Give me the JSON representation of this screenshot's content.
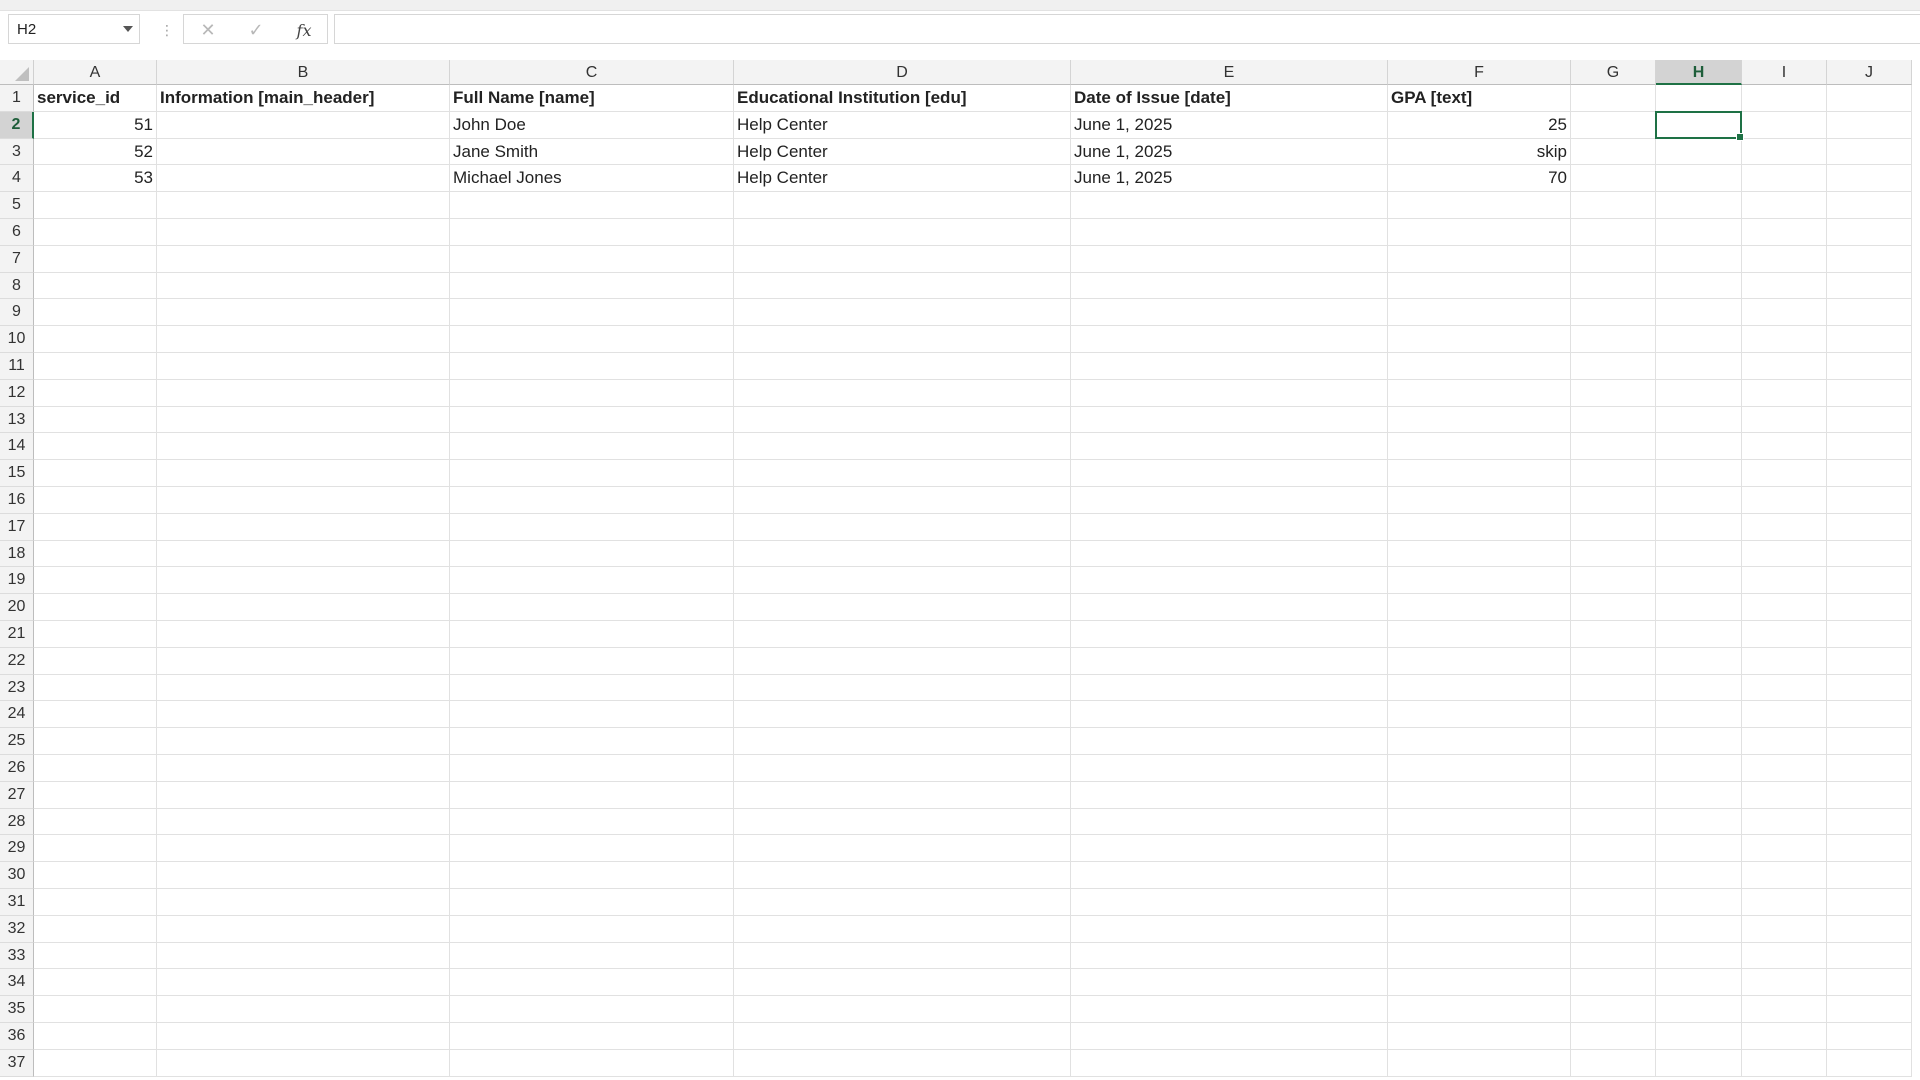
{
  "formula_bar": {
    "name_box": "H2",
    "separator": "⋮",
    "cancel_icon": "✕",
    "enter_icon": "✓",
    "fx_label": "fx",
    "formula": ""
  },
  "columns": [
    "A",
    "B",
    "C",
    "D",
    "E",
    "F",
    "G",
    "H",
    "I",
    "J"
  ],
  "rows": [
    "1",
    "2",
    "3",
    "4",
    "5",
    "6",
    "7",
    "8",
    "9",
    "10",
    "11",
    "12",
    "13",
    "14",
    "15",
    "16",
    "17",
    "18",
    "19",
    "20",
    "21",
    "22",
    "23",
    "24",
    "25",
    "26",
    "27",
    "28",
    "29",
    "30",
    "31",
    "32",
    "33",
    "34",
    "35",
    "36",
    "37"
  ],
  "active_cell": {
    "column": "H",
    "row": "2"
  },
  "accent_color": "#1e7145",
  "cells": {
    "A1": "service_id",
    "B1": "Information [main_header]",
    "C1": "Full Name [name]",
    "D1": "Educational Institution [edu]",
    "E1": "Date of Issue [date]",
    "F1": "GPA [text]",
    "A2": "51",
    "C2": "John Doe",
    "D2": "Help Center",
    "E2": "June 1, 2025",
    "F2": "25",
    "A3": "52",
    "C3": "Jane Smith",
    "D3": "Help Center",
    "E3": "June 1, 2025",
    "F3": "skip",
    "A4": "53",
    "C4": "Michael Jones",
    "D4": "Help Center",
    "E4": "June 1, 2025",
    "F4": "70"
  }
}
